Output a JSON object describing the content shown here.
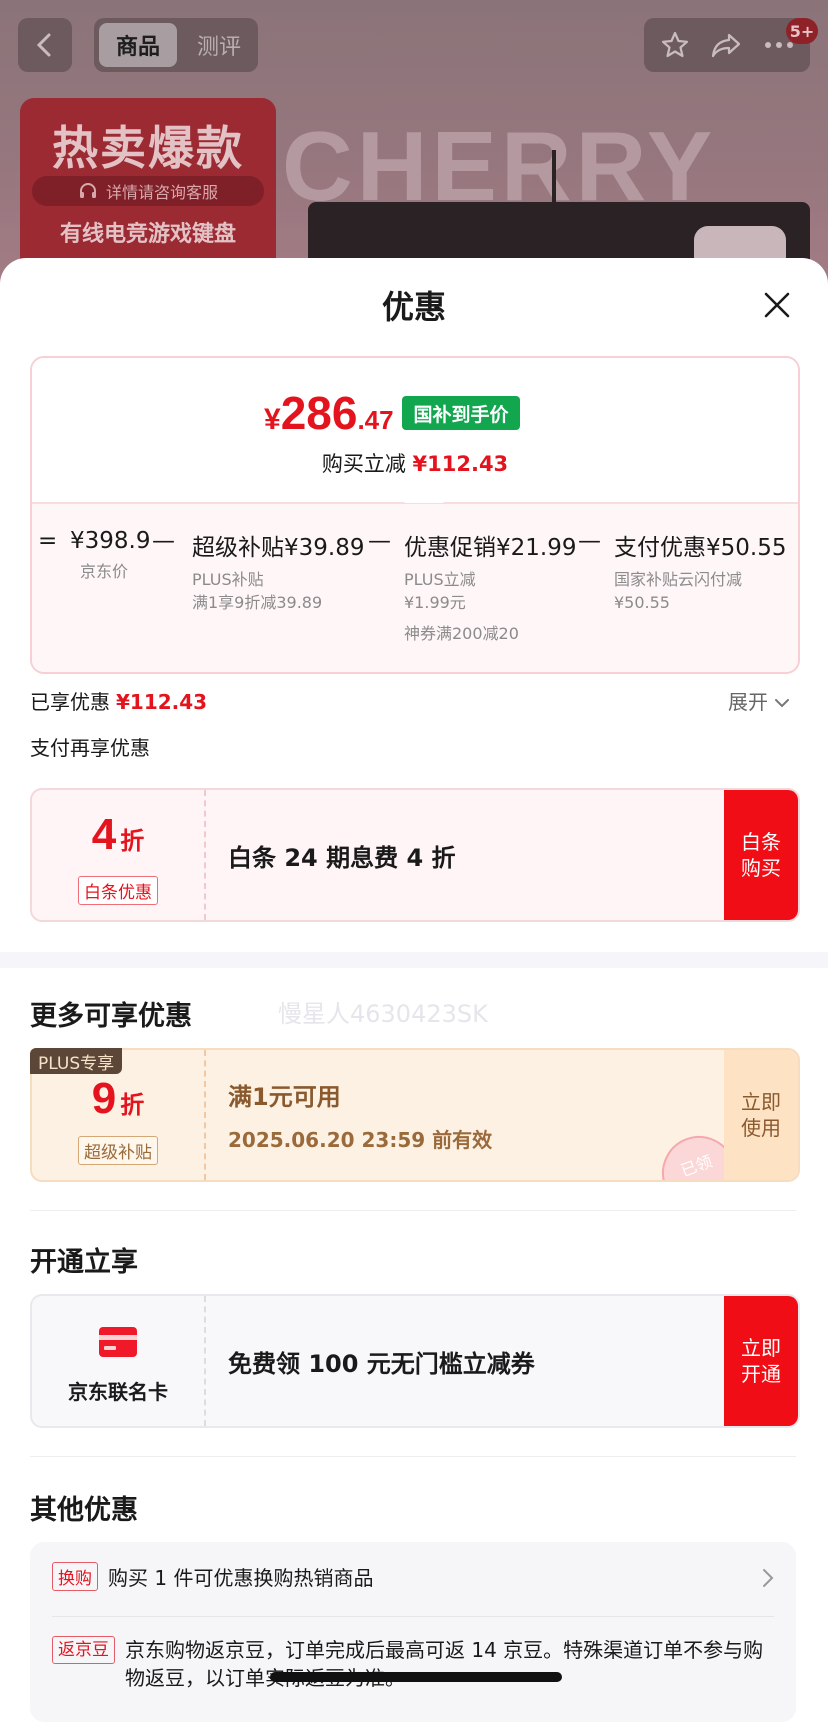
{
  "background": {
    "tabs": [
      "商品",
      "测评"
    ],
    "notification_badge": "5+",
    "promo_title": "热卖爆款",
    "promo_pill": "详情请咨询客服",
    "promo_subtitle": "有线电竞游戏键盘",
    "brand_watermark": "CHERRY"
  },
  "sheet": {
    "title": "优惠",
    "price": {
      "currency": "¥",
      "integer": "286",
      "decimal": ".47",
      "tag": "国补到手价",
      "reduce_label": "购买立减",
      "reduce_value": "¥112.43"
    },
    "breakdown": [
      {
        "main": "¥398.9",
        "subs": [
          "京东价"
        ]
      },
      {
        "main": "超级补贴¥39.89",
        "subs": [
          "PLUS补贴",
          "满1享9折减39.89"
        ]
      },
      {
        "main": "优惠促销¥21.99",
        "subs": [
          "PLUS立减",
          "¥1.99元",
          "神券满200减20"
        ]
      },
      {
        "main": "支付优惠¥50.55",
        "subs": [
          "国家补贴云闪付减",
          "¥50.55"
        ]
      }
    ],
    "operators": [
      "=",
      "—",
      "—",
      "—"
    ],
    "enjoyed_label": "已享优惠",
    "enjoyed_value": "¥112.43",
    "expand_label": "展开",
    "pay_more_label": "支付再享优惠",
    "baitiao": {
      "discount": "4",
      "unit": "折",
      "tag": "白条优惠",
      "desc": "白条 24 期息费 4 折",
      "button": "白条\n购买",
      "watermark": "慢星人4630423SK"
    },
    "more_title": "更多可享优惠",
    "plus_coupon": {
      "badge": "PLUS专享",
      "discount": "9",
      "unit": "折",
      "tag": "超级补贴",
      "title": "满1元可用",
      "expiry": "2025.06.20 23:59 前有效",
      "stamp": "已领",
      "button": "立即\n使用"
    },
    "open_title": "开通立享",
    "card_offer": {
      "card_name": "京东联名卡",
      "desc": "免费领 100 元无门槛立减券",
      "button": "立即\n开通"
    },
    "other_title": "其他优惠",
    "other_items": [
      {
        "tag": "换购",
        "text": "购买 1 件可优惠换购热销商品"
      },
      {
        "tag": "返京豆",
        "text": "京东购物返京豆，订单完成后最高可返 14 京豆。特殊渠道订单不参与购物返豆，以订单实际返豆为准。"
      }
    ]
  },
  "colors": {
    "accent_red": "#e4141e",
    "green_tag": "#12a64f",
    "plus_gold": "#9a6a3a"
  }
}
